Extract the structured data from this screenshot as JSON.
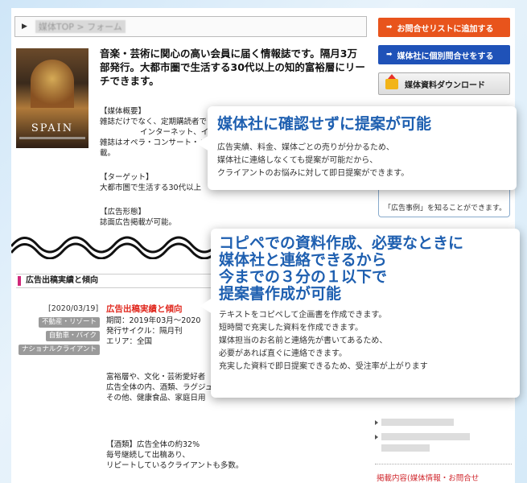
{
  "breadcrumb": {
    "crumb": "媒体TOP > フォーム"
  },
  "cover": {
    "title": "SPAIN"
  },
  "lead": {
    "text": "音楽・芸術に関心の高い会員に届く情報誌です。隔月3万部発行。大都市圏で生活する30代以上の知的富裕層にリーチできます。"
  },
  "profile": {
    "heading": "【媒体概要】",
    "lines": [
      "雑誌だけでなく、定期購読者で",
      "インターネット、イ",
      "雑誌はオペラ・コンサート・バ",
      "載。"
    ],
    "target_heading": "【ターゲット】",
    "target_line": "大都市圏で生活する30代以上",
    "format_heading": "【広告形態】",
    "format_line": "誌面広告掲載が可能。"
  },
  "buttons": {
    "add_list": "お問合せリストに追加する",
    "contact": "媒体社に個別問合せをする",
    "download": "媒体資料ダウンロード"
  },
  "side_frame": {
    "text": "「広告事例」を知ることができます。"
  },
  "section": {
    "title": "広告出稿実績と傾向"
  },
  "record": {
    "date": "[2020/03/19]",
    "title": "広告出稿実績と傾向",
    "tags": [
      "不動産・リゾート",
      "自動車・バイク",
      "ナショナルクライアント"
    ],
    "period": "期間：2019年03月～2020",
    "cycle": "発行サイクル：隔月刊",
    "area": "エリア：全国",
    "notes": [
      "富裕層や、文化・芸術愛好者",
      "広告全体の内、酒類、ラグジュ",
      "その他、健康食品、家庭日用"
    ],
    "liquor_heading": "【酒類】広告全体の約32%",
    "liquor_lines": [
      "毎号継続して出稿あり、",
      "リピートしているクライアントも多数。"
    ]
  },
  "side_note": {
    "text": "掲載内容(媒体情報・お問合せ"
  },
  "callout1": {
    "title": "媒体社に確認せずに提案が可能",
    "lines": [
      "広告実績、料金、媒体ごとの売りが分かるため、",
      "媒体社に連絡しなくても提案が可能だから、",
      "クライアントのお悩みに対して即日提案ができます。"
    ]
  },
  "callout2": {
    "title_lines": [
      "コピペでの資料作成、必要なときに",
      "媒体社と連絡できるから",
      "今までの３分の１以下で",
      "提案書作成が可能"
    ],
    "lines": [
      "テキストをコピペして企画書を作成できます。",
      "短時間で充実した資料を作成できます。",
      "媒体担当のお名前と連絡先が書いてあるため、",
      "必要があれば直ぐに連絡できます。",
      "充実した資料で即日提案できるため、受注率が上がります"
    ]
  },
  "colors": {
    "accent_blue": "#1e5fb0",
    "orange": "#e8541c",
    "blue": "#1f52b8",
    "red": "#e0281e"
  }
}
